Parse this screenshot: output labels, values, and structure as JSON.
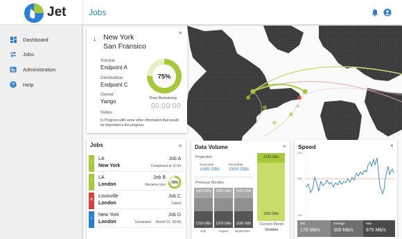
{
  "app": {
    "name": "Jet",
    "page_title": "Jobs"
  },
  "header": {
    "icons": [
      "bell-icon",
      "user-icon"
    ]
  },
  "sidebar": {
    "items": [
      {
        "label": "Dashboard",
        "icon": "dashboard-icon"
      },
      {
        "label": "Jobs",
        "icon": "transfer-arrows-icon"
      },
      {
        "label": "Administration",
        "icon": "admin-icon"
      },
      {
        "label": "Help",
        "icon": "help-icon"
      }
    ]
  },
  "job_detail": {
    "from": "New York",
    "to": "San Fransico",
    "source_label": "Source",
    "source": "Endpoint A",
    "destination_label": "Destination",
    "destination": "Endpoint C",
    "owner_label": "Owner",
    "owner": "Yango",
    "notes_label": "Notes",
    "notes": "In Progress with some other information that would be important to the progress",
    "progress_percent": "75%",
    "progress": 0.75,
    "time_remaining_label": "Time Remaining",
    "time_remaining": "00:00:00",
    "close": "×"
  },
  "jobs_list": {
    "title": "Jobs",
    "close": "×",
    "items": [
      {
        "from": "LA",
        "to": "New York",
        "job": "Job A",
        "status": "Completed at 11:04",
        "color": "#a5c93a",
        "icon": "↓"
      },
      {
        "from": "LA",
        "to": "London",
        "job": "Job B",
        "status": "filename.mov",
        "color": "#a5c93a",
        "icon": "↓",
        "badge": "75%",
        "progress": 0.75
      },
      {
        "from": "Louisville",
        "to": "London",
        "job": "Job C",
        "status": "Failed",
        "color": "#d9403a",
        "icon": "✕"
      },
      {
        "from": "New York",
        "to": "London",
        "job": "Job D",
        "status": "Scheduled     Month 01  00:00",
        "color": "#2a7fd4",
        "icon": "↓"
      }
    ]
  },
  "data_volume": {
    "title": "Data Volume",
    "close": "×",
    "projected_label": "Projected",
    "november_label": "November",
    "november_value": "1445 GBs",
    "december_label": "December",
    "december_value": "1500 GBs",
    "previous_label": "Previous Months",
    "months": [
      {
        "name": "July",
        "top": "1500 GBs",
        "bottom": "1250 GBs"
      },
      {
        "name": "August",
        "top": "1600 GBs",
        "bottom": "1250 GBs"
      },
      {
        "name": "September",
        "top": "1600 GBs",
        "bottom": "1100 GBs"
      }
    ],
    "current_top": "1335 GBs",
    "current_bottom": "1250 GBs",
    "current_label": "Current Month",
    "current_month": "October"
  },
  "speed": {
    "title": "Speed",
    "close": "×",
    "y_top": "430",
    "y_mid": "300",
    "y_bottom": "145",
    "stats": [
      {
        "label": "Min",
        "value": "170 Mb/s"
      },
      {
        "label": "Average",
        "value": "300 Mb/s"
      },
      {
        "label": "Max",
        "value": "675 Mb/s"
      }
    ]
  },
  "colors": {
    "accent": "#2a7fd4",
    "green": "#a5c93a",
    "red": "#d9403a"
  }
}
